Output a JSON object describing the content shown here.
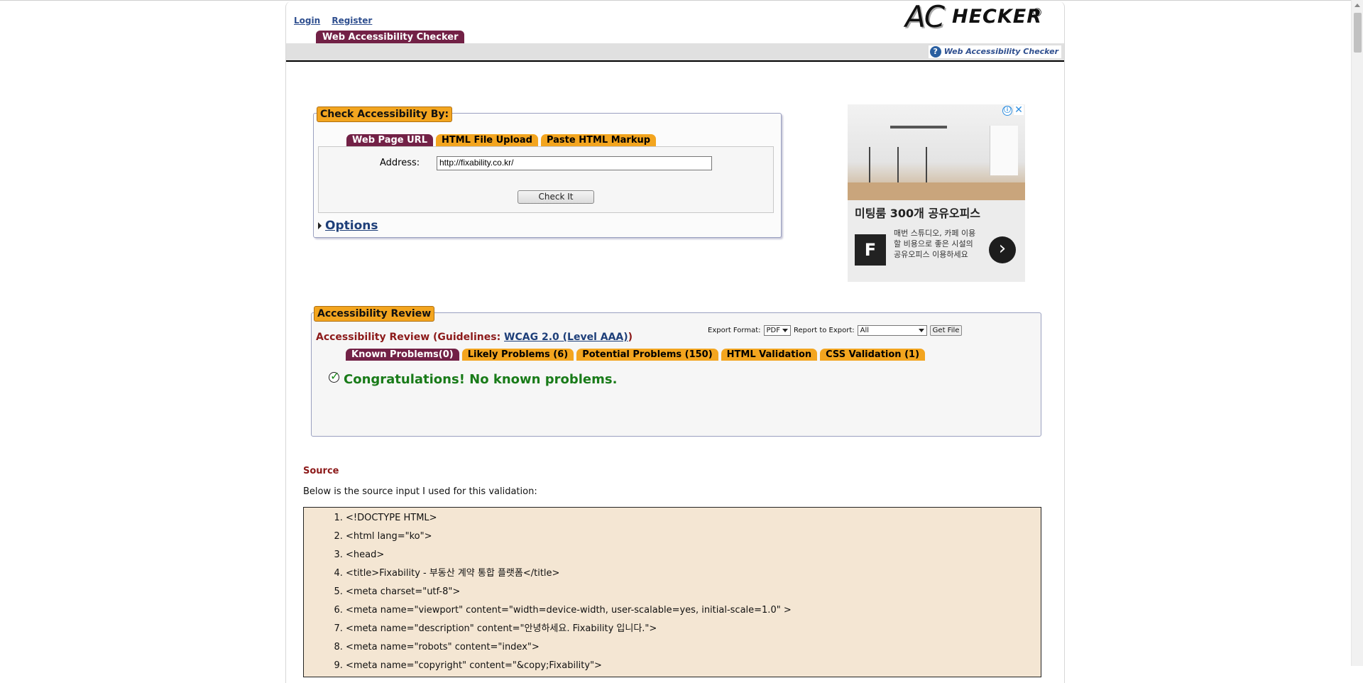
{
  "header": {
    "login": "Login",
    "register": "Register",
    "logo_ac": "AC",
    "logo_hecker": "HECKER",
    "logo_reg": "®",
    "main_tab": "Web Accessibility Checker",
    "help_link": "Web Accessibility Checker"
  },
  "check": {
    "legend": "Check Accessibility By:",
    "tabs": [
      "Web Page URL",
      "HTML File Upload",
      "Paste HTML Markup"
    ],
    "address_label": "Address:",
    "address_value": "http://fixability.co.kr/",
    "check_button": "Check It",
    "options_label": "Options"
  },
  "ad": {
    "headline": "미팅룸 300개 공유오피스",
    "logo_letter": "F",
    "desc": "매번 스튜디오, 카페 이용할 비용으로 좋은 시설의 공유오피스 이용하세요",
    "info_icon": "ⓘ",
    "close_icon": "✕",
    "next_icon": "›"
  },
  "review": {
    "legend": "Accessibility Review",
    "title_prefix": "Accessibility Review (Guidelines: ",
    "guideline_link": "WCAG 2.0 (Level AAA)",
    "title_suffix": ")",
    "export_format_label": "Export Format:",
    "export_format_value": "PDF",
    "report_label": "Report to Export:",
    "report_value": "All",
    "get_file": "Get File",
    "tabs": [
      "Known Problems(0)",
      "Likely Problems (6)",
      "Potential Problems (150)",
      "HTML Validation",
      "CSS Validation (1)"
    ],
    "congrats": "Congratulations! No known problems."
  },
  "source": {
    "heading": "Source",
    "intro": "Below is the source input I used for this validation:",
    "lines": [
      "<!DOCTYPE HTML>",
      "<html lang=\"ko\">",
      "<head>",
      "<title>Fixability - 부동산 계약 통합 플랫폼</title>",
      "<meta charset=\"utf-8\">",
      "<meta name=\"viewport\" content=\"width=device-width, user-scalable=yes, initial-scale=1.0\" >",
      "<meta name=\"description\" content=\"안녕하세요. Fixability 입니다.\">",
      "<meta name=\"robots\" content=\"index\">",
      "<meta name=\"copyright\" content=\"&copy;Fixability\">"
    ]
  }
}
